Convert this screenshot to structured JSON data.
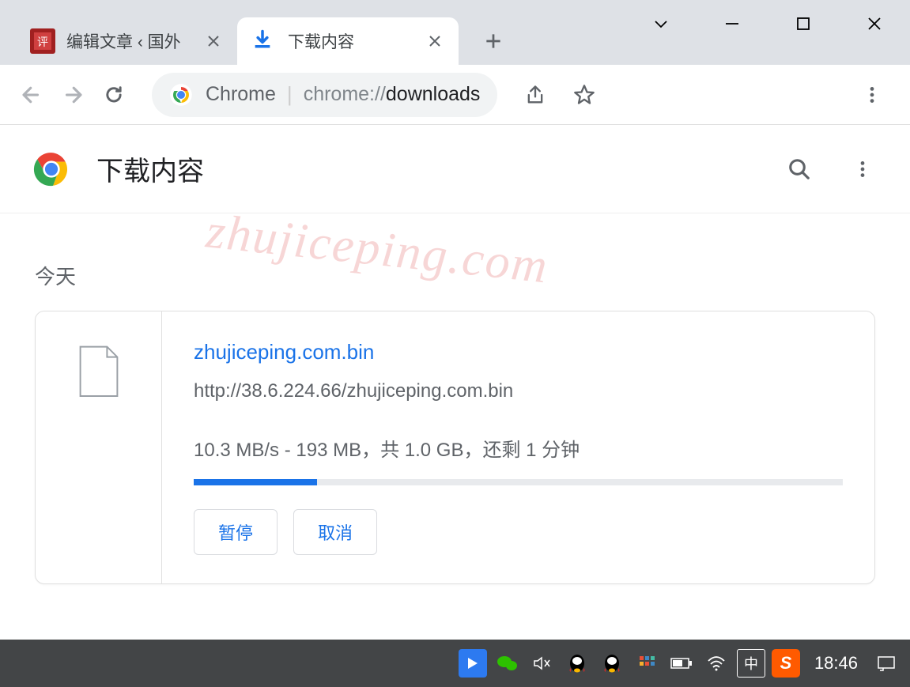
{
  "tabs": [
    {
      "title": "编辑文章 ‹ 国外",
      "active": false
    },
    {
      "title": "下载内容",
      "active": true
    }
  ],
  "omnibox": {
    "app_label": "Chrome",
    "url_prefix": "chrome://",
    "url_path": "downloads"
  },
  "downloads": {
    "title": "下载内容",
    "date_label": "今天",
    "items": [
      {
        "filename": "zhujiceping.com.bin",
        "url": "http://38.6.224.66/zhujiceping.com.bin",
        "status": "10.3 MB/s - 193 MB，共 1.0 GB，还剩 1 分钟",
        "progress_percent": 19,
        "pause_label": "暂停",
        "cancel_label": "取消"
      }
    ]
  },
  "watermark": "zhujiceping.com",
  "taskbar": {
    "time": "18:46",
    "ime": "中"
  }
}
